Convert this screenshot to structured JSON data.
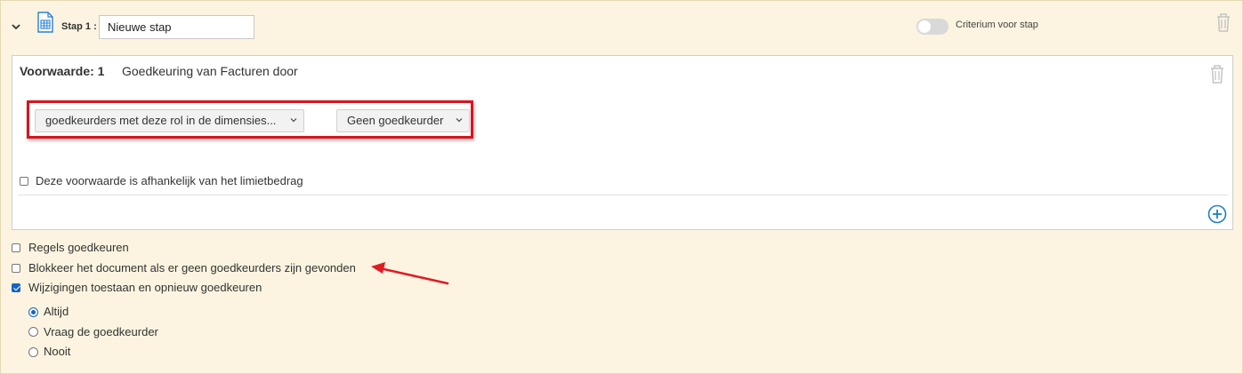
{
  "step": {
    "label": "Stap 1 :",
    "name_value": "Nieuwe stap",
    "criterium_label": "Criterium voor stap",
    "criterium_enabled": false
  },
  "condition": {
    "title": "Voorwaarde: 1",
    "description": "Goedkeuring van Facturen door",
    "approver_type_selected": "goedkeurders met deze rol in de dimensies...",
    "approver_selected": "Geen goedkeurder",
    "limit_dependent_label": "Deze voorwaarde is afhankelijk van het limietbedrag",
    "limit_dependent_checked": false
  },
  "options": {
    "approve_rules_label": "Regels goedkeuren",
    "approve_rules_checked": false,
    "block_document_label": "Blokkeer het document als er geen goedkeurders zijn gevonden",
    "block_document_checked": false,
    "allow_changes_label": "Wijzigingen toestaan en opnieuw goedkeuren",
    "allow_changes_checked": true,
    "reapprove_modes": [
      {
        "label": "Altijd",
        "selected": true
      },
      {
        "label": "Vraag de goedkeurder",
        "selected": false
      },
      {
        "label": "Nooit",
        "selected": false
      }
    ]
  },
  "colors": {
    "accent": "#1565c0",
    "highlight_red": "#d9141c",
    "background": "#fcf4e0"
  },
  "icons": [
    "chevron-down-icon",
    "spreadsheet-document-icon",
    "trash-icon",
    "plus-circle-icon",
    "annotation-arrow"
  ]
}
